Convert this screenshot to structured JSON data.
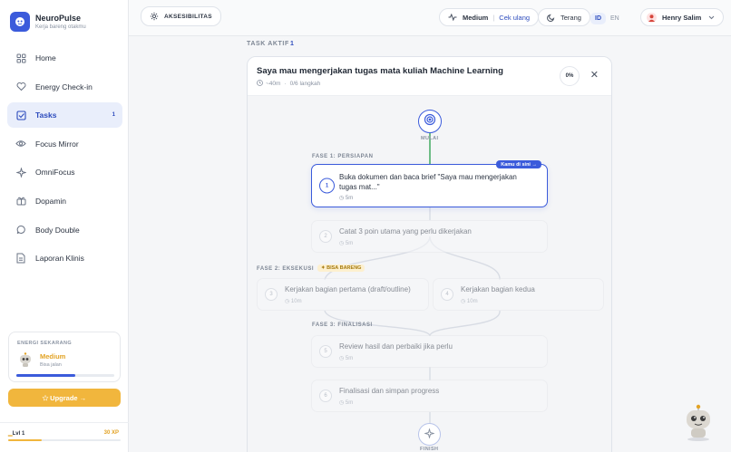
{
  "brand": {
    "name": "NeuroPulse",
    "tagline": "Kerja bareng otakmu"
  },
  "nav": [
    {
      "label": "Home",
      "icon": "grid-icon"
    },
    {
      "label": "Energy Check-in",
      "icon": "heart-icon"
    },
    {
      "label": "Tasks",
      "icon": "checkbox-icon",
      "badge": "1",
      "active": true
    },
    {
      "label": "Focus Mirror",
      "icon": "eye-icon"
    },
    {
      "label": "OmniFocus",
      "icon": "sparkle-icon"
    },
    {
      "label": "Dopamin",
      "icon": "gift-icon"
    },
    {
      "label": "Body Double",
      "icon": "chat-bubble-icon"
    },
    {
      "label": "Laporan Klinis",
      "icon": "document-icon"
    }
  ],
  "energy": {
    "title": "ENERGI SEKARANG",
    "level": "Medium",
    "sub": "Bisa jalan",
    "fill": 0.6
  },
  "upgrade": {
    "label": "✩ Upgrade →"
  },
  "progress": {
    "level": "Lvl 1",
    "xp": "30 XP",
    "fill": 0.3
  },
  "topbar": {
    "access_label": "AKSESIBILITAS",
    "energy_state": "Medium",
    "energy_action": "Cek ulang",
    "theme": "Terang",
    "lang_active": "ID",
    "lang_other": "EN",
    "user": "Henry Salim"
  },
  "task_section": {
    "label": "TASK AKTIF",
    "count": "1"
  },
  "task": {
    "title": "Saya mau mengerjakan tugas mata kuliah Machine Learning",
    "duration": "~40m",
    "steps_done": "0/6 langkah",
    "percent": "0%"
  },
  "flow": {
    "start_label": "MULAI",
    "finish_label": "FINISH",
    "phase1": "FASE 1: PERSIAPAN",
    "phase2": "FASE 2: EKSEKUSI",
    "phase2_tag": "BISA BARENG",
    "phase3": "FASE 3: FINALISASI",
    "here_badge": "Kamu di sini →",
    "steps": [
      {
        "num": "1",
        "text": "Buka dokumen dan baca brief \"Saya mau mengerjakan tugas mat...\"",
        "time": "5m"
      },
      {
        "num": "2",
        "text": "Catat 3 poin utama yang perlu dikerjakan",
        "time": "5m"
      },
      {
        "num": "3",
        "text": "Kerjakan bagian pertama (draft/outline)",
        "time": "10m"
      },
      {
        "num": "4",
        "text": "Kerjakan bagian kedua",
        "time": "10m"
      },
      {
        "num": "5",
        "text": "Review hasil dan perbaiki jika perlu",
        "time": "5m"
      },
      {
        "num": "6",
        "text": "Finalisasi dan simpan progress",
        "time": "5m"
      }
    ]
  },
  "colors": {
    "accent": "#3b5bdb",
    "gold": "#f1b63d",
    "start_line": "#4caf6a"
  }
}
